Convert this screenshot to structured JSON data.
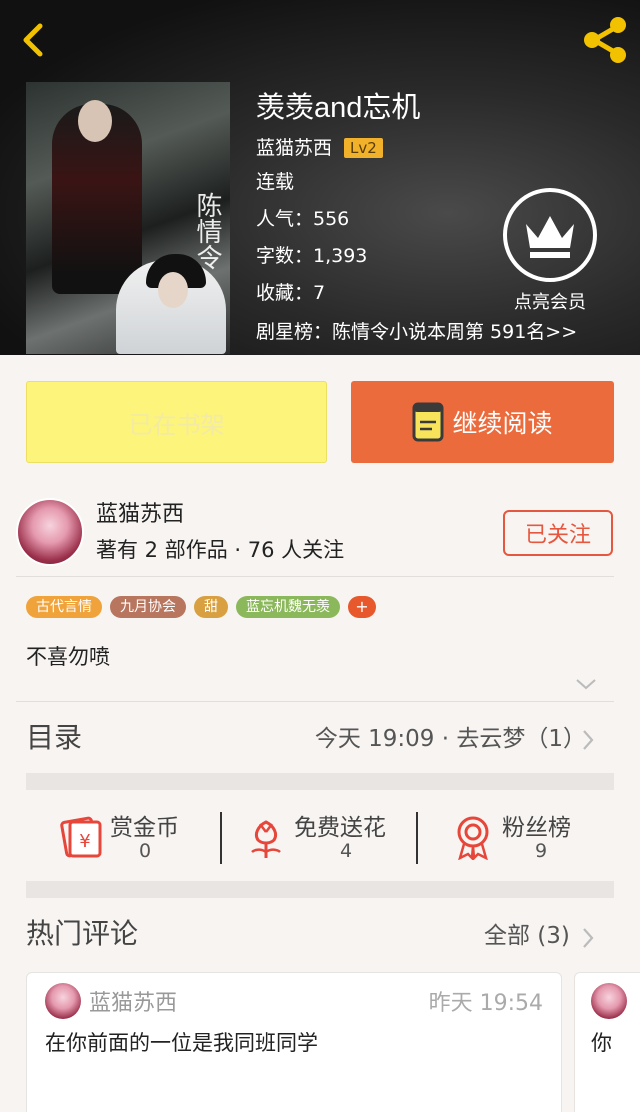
{
  "book": {
    "title": "羡羡and忘机",
    "author": "蓝猫苏西",
    "level": "Lv2",
    "status": "连载",
    "popularity": "人气：556",
    "word_count": "字数：1,393",
    "favorites": "收藏：7",
    "rank": "剧星榜：陈情令小说本周第 591名>>",
    "cover_calligraphy": "陈情令"
  },
  "vip": {
    "label": "点亮会员"
  },
  "actions": {
    "shelf_label": "已在书架",
    "read_label": "继续阅读"
  },
  "author_card": {
    "name": "蓝猫苏西",
    "stats": "著有 2 部作品 · 76 人关注",
    "follow_label": "已关注"
  },
  "tags": [
    {
      "label": "古代言情",
      "color": "#f0a33a"
    },
    {
      "label": "九月协会",
      "color": "#b8765f"
    },
    {
      "label": "甜",
      "color": "#d8a040"
    },
    {
      "label": "蓝忘机魏无羡",
      "color": "#8bb85a"
    }
  ],
  "tag_add": "+",
  "description": "不喜勿喷",
  "toc": {
    "label": "目录",
    "latest": "今天 19:09 · 去云梦（1）"
  },
  "stats": [
    {
      "label": "赏金币",
      "value": "0",
      "icon": "red-envelope-icon"
    },
    {
      "label": "免费送花",
      "value": "4",
      "icon": "flower-icon"
    },
    {
      "label": "粉丝榜",
      "value": "9",
      "icon": "medal-icon"
    }
  ],
  "hot_comments": {
    "label": "热门评论",
    "all_label": "全部 (3)",
    "items": [
      {
        "user": "蓝猫苏西",
        "time": "昨天 19:54",
        "text": "在你前面的一位是我同班同学"
      },
      {
        "text": "你"
      }
    ]
  },
  "colors": {
    "accent": "#eb6b3c",
    "shelf": "#fdf47c",
    "follow": "#e6573f",
    "gold": "#f2b12a"
  }
}
